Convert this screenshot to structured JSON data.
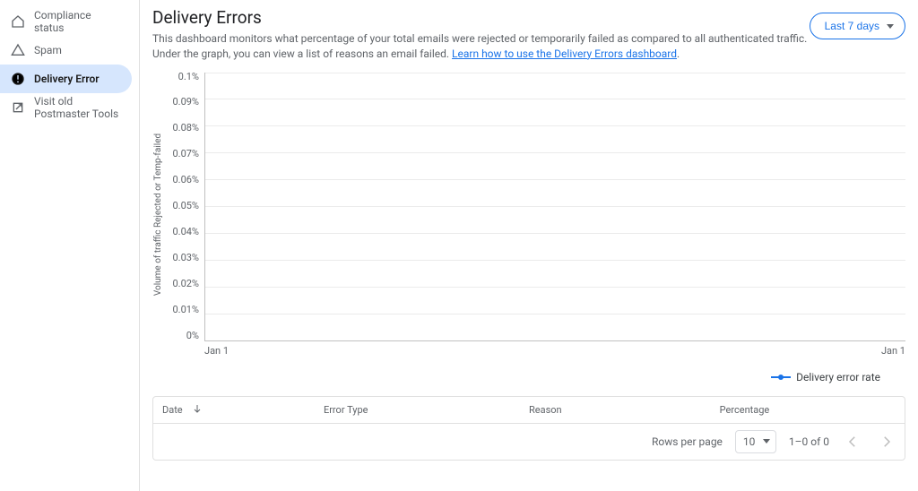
{
  "sidebar": {
    "items": [
      {
        "label": "Compliance status"
      },
      {
        "label": "Spam"
      },
      {
        "label": "Delivery Error"
      },
      {
        "label": "Visit old Postmaster Tools"
      }
    ]
  },
  "header": {
    "title": "Delivery Errors",
    "desc_before_link": "This dashboard monitors what percentage of your total emails were rejected or temporarily failed as compared to all authenticated traffic. Under the graph, you can view a list of reasons an email failed. ",
    "link_text": "Learn how to use the Delivery Errors dashboard",
    "desc_after_link": ".",
    "range_chip": "Last 7 days"
  },
  "chart_data": {
    "type": "line",
    "title": "",
    "xlabel": "",
    "ylabel": "Volume of traffic Rejected or Temp-failed",
    "ylim": [
      0,
      0.1
    ],
    "yticks": [
      "0.1%",
      "0.09%",
      "0.08%",
      "0.07%",
      "0.06%",
      "0.05%",
      "0.04%",
      "0.03%",
      "0.02%",
      "0.01%",
      "0%"
    ],
    "xticks": [
      "Jan 1",
      "Jan 1"
    ],
    "series": [
      {
        "name": "Delivery error rate",
        "values": []
      }
    ],
    "legend_color": "#1a73e8"
  },
  "table": {
    "columns": [
      "Date",
      "Error Type",
      "Reason",
      "Percentage"
    ],
    "rows_per_page_label": "Rows per page",
    "rows_per_page_value": "10",
    "range_text": "1–0 of 0"
  }
}
